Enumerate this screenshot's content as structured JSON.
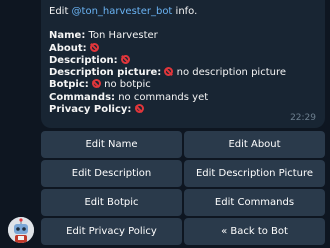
{
  "message": {
    "intro_prefix": "Edit ",
    "mention": "@ton_harvester_bot",
    "intro_suffix": " info.",
    "name_label": "Name:",
    "name_value": " Ton Harvester",
    "about_label": "About:",
    "description_label": "Description:",
    "description_picture_label": "Description picture:",
    "description_picture_value": " no description picture",
    "botpic_label": "Botpic:",
    "botpic_value": " no botpic",
    "commands_label": "Commands:",
    "commands_value": " no commands yet",
    "privacy_label": "Privacy Policy:",
    "time": "22:29"
  },
  "keyboard": {
    "edit_name": "Edit Name",
    "edit_about": "Edit About",
    "edit_description": "Edit Description",
    "edit_description_picture": "Edit Description Picture",
    "edit_botpic": "Edit Botpic",
    "edit_commands": "Edit Commands",
    "edit_privacy_policy": "Edit Privacy Policy",
    "back_to_bot": "« Back to Bot"
  },
  "icons": {
    "not_set": "no-entry-icon",
    "avatar": "bot-avatar"
  },
  "colors": {
    "background": "#0e1621",
    "bubble": "#182533",
    "button": "#2a3a4b",
    "mention": "#6ab3f3",
    "no_entry": "#e0363b"
  }
}
